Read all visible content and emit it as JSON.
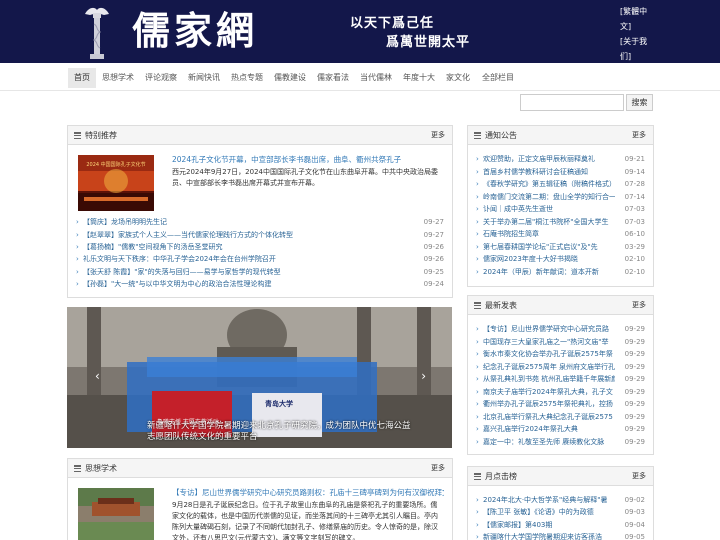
{
  "header": {
    "logo_text": "儒家網",
    "slogan1": "以天下爲己任",
    "slogan2": "爲萬世開太平",
    "top_links": [
      "[繁體中文]",
      "[关于我们]",
      "[编辑团队]"
    ]
  },
  "nav": {
    "items": [
      "首页",
      "思想学术",
      "评论观察",
      "新闻快讯",
      "热点专题",
      "儒教建设",
      "儒家看法",
      "当代儒林",
      "年度十大",
      "家文化",
      "全部栏目"
    ]
  },
  "search": {
    "button_label": "搜索",
    "placeholder": ""
  },
  "featured": {
    "title": "特别推荐",
    "more": "更多",
    "lead_title": "2024孔子文化节开幕，中宣部部长李书磊出席，曲阜、衢州共祭孔子",
    "lead_desc": "西元2024年9月27日，2024中国国际孔子文化节在山东曲阜开幕。中共中央政治局委员、中宣部部长李书磊出席开幕式并宣布开幕。",
    "thumb_caption": "2024 中国国际孔子文化节",
    "items": [
      {
        "text": "【筒庆】龙场吊明明先生记",
        "date": "09-27"
      },
      {
        "text": "【赵翠翠】家族式个人主义——当代儒家伦理践行方式的个体化转型",
        "date": "09-27"
      },
      {
        "text": "【葛扬楠】\"儒教\"空间视角下的汤岳圣堂研究",
        "date": "09-26"
      },
      {
        "text": "礼乐文明与天下秩序：中华孔子学会2024年会在台州学院召开",
        "date": "09-26"
      },
      {
        "text": "【张天舒 陈霞】\"家\"的失落与回归——易学与家哲学的现代转型",
        "date": "09-25"
      },
      {
        "text": "【孙磊】\"大一统\"与以中华文明为中心的政治合法性理论构建",
        "date": "09-24"
      }
    ]
  },
  "slider": {
    "caption": "新疆喀什大学国学院暑期迎来北京孔子研究院，成为团队中优七海公益志愿团队传统文化的重要平台",
    "banner_left": "鲁曦支援 志愿支教活动",
    "banner_right": "青岛大学"
  },
  "academic": {
    "title": "思想学术",
    "more": "更多",
    "lead_title": "【专访】尼山世界儒学研究中心研究员路则权：孔庙十三碑亭碑到为何有汉御祝拜文字？",
    "lead_desc": "9月28日是孔子诞辰纪念日。位于孔子故里山东曲阜的孔庙是祭祀孔子的重要场所。儒家文化的载体，也是中国历代崇儒的见证，而坐落其间的十三碑亭尤其引人瞩目。亭内陈列大量碑碣石刻，记录了不同朝代加封孔子、修缮祭庙的历史。令人惊奇的是，除汉文外，还有八思巴文(元代蒙古文)、满文等文字刻写的碑文。"
  },
  "notices": {
    "title": "通知公告",
    "more": "更多",
    "items": [
      {
        "text": "欢迎赞助，正定文庙甲辰秋丽释奠礼",
        "date": "09-21"
      },
      {
        "text": "首届乡村儒学教科研讨会征稿通知",
        "date": "09-14"
      },
      {
        "text": "《春秋学研究》第五辑征稿（附稿件格式）",
        "date": "07-28"
      },
      {
        "text": "岭南儒门交流第二期：盘山全学的知行合一",
        "date": "07-14"
      },
      {
        "text": "讣闻｜成中英先生逝世",
        "date": "07-03"
      },
      {
        "text": "关于举办第二届\"桐江书院杯\"全国大学生",
        "date": "07-03"
      },
      {
        "text": "石庵书院招生简章",
        "date": "06-10"
      },
      {
        "text": "第七届春耕国学论坛\"正式启议\"及\"先",
        "date": "03-29"
      },
      {
        "text": "儒家网2023年度十大好书揭晓",
        "date": "02-10"
      },
      {
        "text": "2024年（甲辰）新年献词：道本开新",
        "date": "02-10"
      }
    ]
  },
  "latest": {
    "title": "最新发表",
    "more": "更多",
    "items": [
      {
        "text": "【专访】尼山世界儒学研究中心研究员路",
        "date": "09-29"
      },
      {
        "text": "中国现存三大皇家孔庙之一\"热河文庙\"举",
        "date": "09-29"
      },
      {
        "text": "衡水市秦文化协会举办孔子诞辰2575年祭",
        "date": "09-29"
      },
      {
        "text": "纪念孔子诞辰2575周年 泉州府文庙举行孔",
        "date": "09-29"
      },
      {
        "text": "从祭孔典礼到书苑 杭州孔庙举籍千年展新颜",
        "date": "09-29"
      },
      {
        "text": "南京夫子庙举行2024年祭孔大典，孔子文",
        "date": "09-29"
      },
      {
        "text": "衢州举办孔子诞辰2575年祭祀典礼，控扬",
        "date": "09-29"
      },
      {
        "text": "北京孔庙举行祭孔大典纪念孔子诞辰2575",
        "date": "09-29"
      },
      {
        "text": "嘉兴孔庙举行2024年祭孔大典",
        "date": "09-29"
      },
      {
        "text": "嘉定一中：礼敬至圣先师 赓续教化文脉",
        "date": "09-29"
      }
    ]
  },
  "monthly": {
    "title": "月点击榜",
    "more": "更多",
    "items": [
      {
        "text": "2024年北大·中大哲学系\"经典与解释\"暑",
        "date": "09-02"
      },
      {
        "text": "【陈卫平 张敏】《论语》中的为政德",
        "date": "09-03"
      },
      {
        "text": "【儒家邮报】第403期",
        "date": "09-04"
      },
      {
        "text": "新疆喀什大学国学院暑期迎来访客孫浩",
        "date": "09-05"
      }
    ]
  }
}
